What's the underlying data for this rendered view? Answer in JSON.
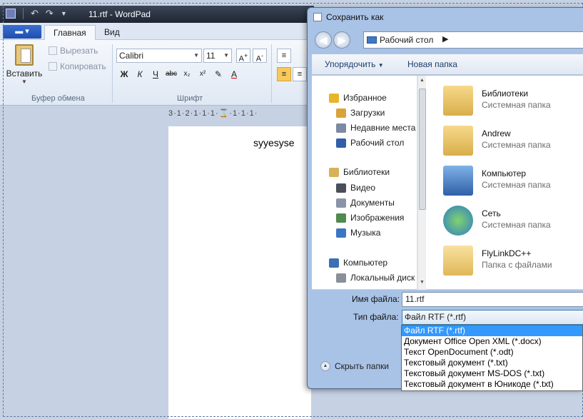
{
  "wordpad": {
    "title": "11.rtf - WordPad",
    "tabs": [
      "Главная",
      "Вид"
    ],
    "clipboard": {
      "paste": "Вставить",
      "cut": "Вырезать",
      "copy": "Копировать",
      "group": "Буфер обмена"
    },
    "font": {
      "family": "Calibri",
      "size": "11",
      "group": "Шрифт"
    },
    "ruler": "3·1·2·1·1·1·⌛·1·1·1·",
    "document_text": "syyesyse"
  },
  "dialog": {
    "title": "Сохранить как",
    "address": "Рабочий стол",
    "toolbar": {
      "organize": "Упорядочить",
      "new_folder": "Новая папка"
    },
    "nav_tree": [
      {
        "label": "Избранное",
        "icon": "star-icon",
        "color": "#e8b52a"
      },
      {
        "label": "Загрузки",
        "icon": "downloads-icon",
        "color": "#d9a23b"
      },
      {
        "label": "Недавние места",
        "icon": "recent-icon",
        "color": "#7c8aa3"
      },
      {
        "label": "Рабочий стол",
        "icon": "desktop-icon",
        "color": "#2f5fa8"
      },
      {
        "label": "Библиотеки",
        "icon": "libraries-icon",
        "color": "#d7b257"
      },
      {
        "label": "Видео",
        "icon": "video-icon",
        "color": "#4a4f5a"
      },
      {
        "label": "Документы",
        "icon": "documents-icon",
        "color": "#8a94a6"
      },
      {
        "label": "Изображения",
        "icon": "pictures-icon",
        "color": "#4f8a4f"
      },
      {
        "label": "Музыка",
        "icon": "music-icon",
        "color": "#3b76c4"
      },
      {
        "label": "Компьютер",
        "icon": "computer-icon",
        "color": "#3c6fb3"
      },
      {
        "label": "Локальный диск",
        "icon": "drive-icon",
        "color": "#8a8f99"
      }
    ],
    "files": [
      {
        "name": "Библиотеки",
        "sub": "Системная папка",
        "icon": "libraries-folder-icon"
      },
      {
        "name": "Andrew",
        "sub": "Системная папка",
        "icon": "user-folder-icon"
      },
      {
        "name": "Компьютер",
        "sub": "Системная папка",
        "icon": "computer-icon"
      },
      {
        "name": "Сеть",
        "sub": "Системная папка",
        "icon": "network-icon"
      },
      {
        "name": "FlyLinkDC++",
        "sub": "Папка с файлами",
        "icon": "folder-icon"
      }
    ],
    "file_name_label": "Имя файла:",
    "file_name_value": "11.rtf",
    "file_type_label": "Тип файла:",
    "file_type_value": "Файл RTF (*.rtf)",
    "hide_folders": "Скрыть папки",
    "file_type_options": [
      "Файл RTF (*.rtf)",
      "Документ Office Open XML (*.docx)",
      "Текст OpenDocument (*.odt)",
      "Текстовый документ (*.txt)",
      "Текстовый документ MS-DOS (*.txt)",
      "Текстовый документ в Юникоде (*.txt)"
    ]
  }
}
